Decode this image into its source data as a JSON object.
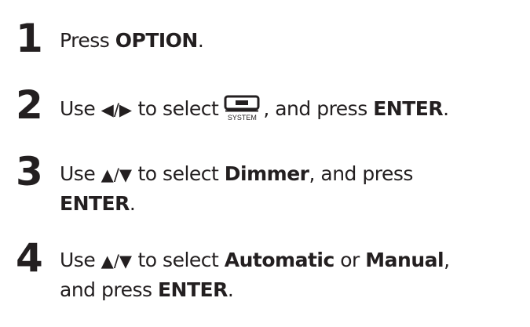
{
  "steps": [
    {
      "number": "1",
      "line1": {
        "press": "Press",
        "option": "OPTION",
        "period": "."
      }
    },
    {
      "number": "2",
      "line1": {
        "use": "Use",
        "arrows": "◀/▶",
        "to_select": "to select",
        "icon_name": "system-icon",
        "icon_label": "SYSTEM",
        "and_press": ", and press",
        "enter": "ENTER",
        "period": "."
      }
    },
    {
      "number": "3",
      "line1": {
        "use": "Use",
        "arrows": "▲/▼",
        "to_select": "to select",
        "dimmer": "Dimmer",
        "and_press": ", and press"
      },
      "line2": {
        "enter": "ENTER",
        "period": "."
      }
    },
    {
      "number": "4",
      "line1": {
        "use": "Use",
        "arrows": "▲/▼",
        "to_select": "to select",
        "automatic": "Automatic",
        "or": "or",
        "manual": "Manual",
        "comma": ","
      },
      "line2": {
        "and_press": "and press",
        "enter": "ENTER",
        "period": "."
      }
    }
  ]
}
